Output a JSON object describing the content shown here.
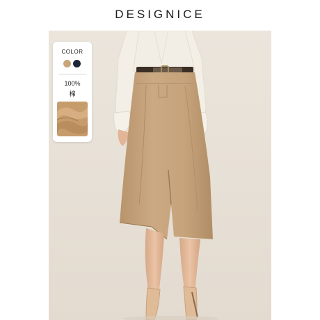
{
  "brand": "DESIGNICE",
  "badge": {
    "color_label": "COLOR",
    "swatches": [
      {
        "name": "khaki",
        "hex": "#c9a57a"
      },
      {
        "name": "navy",
        "hex": "#1d2638"
      }
    ],
    "material_percent": "100%",
    "material_name": "棉"
  },
  "colors": {
    "background": "#e8e1d8",
    "skirt": "#c8a57d",
    "shirt": "#f2eee5",
    "skin": "#e4b99a",
    "shoes": "#e1bd9c"
  }
}
